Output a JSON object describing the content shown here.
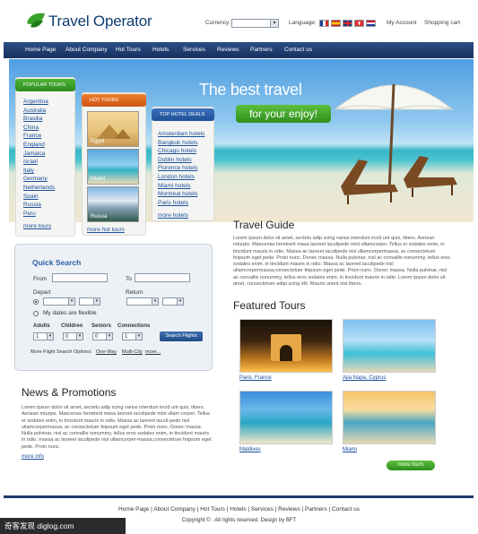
{
  "header": {
    "logo_text": "Travel Operator",
    "currency_label": "Currency:",
    "language_label": "Language:",
    "my_account": "My Account",
    "shopping_cart": "Shopping cart"
  },
  "nav": [
    "Home Page",
    "About Company",
    "Hot Tours",
    "Hotels",
    "Services",
    "Reviews",
    "Partners",
    "Contact us"
  ],
  "hero": {
    "title": "The best travel",
    "subtitle": "for your enjoy!"
  },
  "popular_tours": {
    "heading": "POPULAR TOURS",
    "items": [
      "Argentina",
      "Australia",
      "Brasilia",
      "China",
      "France",
      "England",
      "Jamaica",
      "Israel",
      "Italy",
      "Germany",
      "Netherlands",
      "Spain",
      "Russia",
      "Peru"
    ],
    "more": "more tours"
  },
  "hot_tours": {
    "heading": "HOT TOURS",
    "items": [
      "Egypt",
      "Miami",
      "Russia"
    ],
    "more": "more hot tours"
  },
  "top_hotel_deals": {
    "heading": "TOP HOTEL DEALS",
    "items": [
      "Amsterdam hotels",
      "Bangkok hotels",
      "Chicago hotels",
      "Dublin hotels",
      "Florence hotels",
      "London hotels",
      "Miami hotels",
      "Montreal hotels",
      "Paris hotels"
    ],
    "more": "more hotels"
  },
  "quick_search": {
    "title": "Quick Search",
    "from_label": "From",
    "to_label": "To",
    "depart_label": "Depart",
    "return_label": "Return",
    "flexible_label": "My dates are flexible",
    "adults_label": "Adults",
    "children_label": "Children",
    "seniors_label": "Seniors",
    "connections_label": "Connections",
    "adults_value": "1",
    "children_value": "0",
    "seniors_value": "0",
    "connections_value": "1",
    "button": "Search Flights",
    "options_label": "More Flight Search Options:",
    "option_oneway": "One-Way",
    "option_multicity": "Multi-City",
    "option_more": "more..."
  },
  "travel_guide": {
    "heading": "Travel Guide",
    "text": "Lorem ipsum dolor sit amet, sectetu adip scing varius interdum incid unt quis, libero. Aenean mturpis. Maecenas hendrerit masa laoreet iaculipede mtsl ullamcorper. Tellus er sodales enim, in tincidunt mauris in odio. Massa ac laoreet iaculipede nisl ullamcorpermassa, ac consectetuer feipsum eget pede. Proin nunc. Donec massa. Nulla pulvinar, nisl ac convallis nonummy, tellus eros sodales enim, in tincidunt mauris in odio. Massa ac laoreet iaculipede nisl ullamcorpermassa,consectetuer feipsum eget pede. Proin nunc. Donec massa. Nulla pulvinar, nisl ac convallis nonummy, tellus eros sodales enim, in tincidunt mauris in odio. Lorem ipsum dolor sit amet, consectetuer adipi scing elit. Mauris urient nisl libero."
  },
  "featured_tours": {
    "heading": "Featured Tours",
    "items": [
      "Paris, France",
      "Ajia Napa, Cyprus",
      "Maldives",
      "Miami"
    ],
    "more": "more tours"
  },
  "news": {
    "heading": "News & Promotions",
    "text": "Lorem ipsum dolor sit amet, sectetu adip scing varius interdum incid unt quis, libero. Aenean mturpis. Maecenas hendrerit masa laoreet iaculipede mtsl ullam corper. Tellus er sodales enim, in tincidunt mauris in odio. Massa ac laoreet iacuIi-pede nisl ullamcorpermassa, ac consectetuer feipsum eget pede. Proin nunc. Donec massa. Nulla pulvinar, nisl ac convallis nonummy, tellus eros sodales enim, in tincidunt mauris in odio. massa ac laoreet iaculipede nisl ullamcorper-massa,consectetuer feipsum eget pede. Proin nunc.",
    "more": "more info"
  },
  "footer": {
    "links": "Home Page | About Company | Hot Tours | Hotels | Services | Reviews | Partners | Contact us",
    "copyright": "Copyright © . All rights reserved. Design by BFT"
  },
  "watermark": "奇客发现 diglog.com",
  "colors": {
    "brand": "#0e3b73",
    "nav": "#1e3a6a",
    "accent_green": "#3a9a28",
    "hot_orange": "#e0651a",
    "deals_blue": "#2a5ea8"
  }
}
